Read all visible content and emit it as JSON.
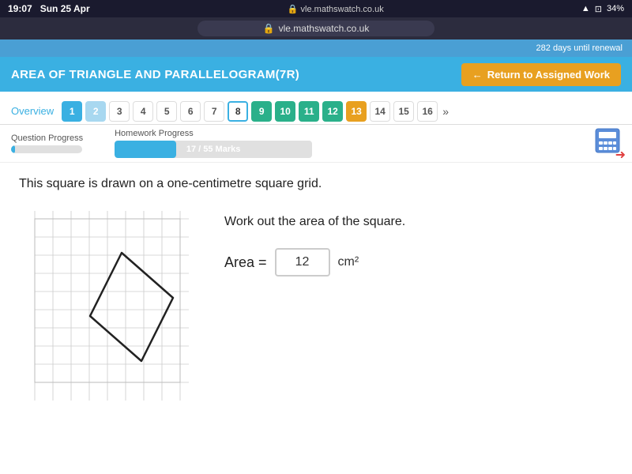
{
  "statusBar": {
    "time": "19:07",
    "date": "Sun 25 Apr",
    "url": "vle.mathswatch.co.uk",
    "lockIcon": "🔒",
    "battery": "34%",
    "wifiIcon": "wifi",
    "batteryIcon": "battery"
  },
  "renewalBanner": {
    "text": "282 days until renewal"
  },
  "header": {
    "title": "AREA OF TRIANGLE AND PARALLELOGRAM(7R)",
    "returnBtn": "Return to Assigned Work"
  },
  "nav": {
    "overviewLabel": "Overview",
    "tabs": [
      {
        "num": "1",
        "style": "blue"
      },
      {
        "num": "2",
        "style": "light-blue"
      },
      {
        "num": "3",
        "style": "plain"
      },
      {
        "num": "4",
        "style": "plain"
      },
      {
        "num": "5",
        "style": "plain"
      },
      {
        "num": "6",
        "style": "plain"
      },
      {
        "num": "7",
        "style": "plain"
      },
      {
        "num": "8",
        "style": "active-outline"
      },
      {
        "num": "9",
        "style": "teal"
      },
      {
        "num": "10",
        "style": "teal"
      },
      {
        "num": "11",
        "style": "teal"
      },
      {
        "num": "12",
        "style": "teal"
      },
      {
        "num": "13",
        "style": "orange"
      },
      {
        "num": "14",
        "style": "plain"
      },
      {
        "num": "15",
        "style": "plain"
      },
      {
        "num": "16",
        "style": "plain"
      },
      {
        "num": "»",
        "style": "plain"
      }
    ]
  },
  "progress": {
    "questionLabel": "Question Progress",
    "questionFill": 5,
    "homeworkLabel": "Homework Progress",
    "homeworkMarks": "17 / 55 Marks",
    "homeworkFillPercent": 31
  },
  "question": {
    "questionText": "This square is drawn on a one-centimetre square grid.",
    "workOutText": "Work out the area of the square.",
    "areaLabel": "Area =",
    "areaValue": "12",
    "areaUnit": "cm²"
  }
}
